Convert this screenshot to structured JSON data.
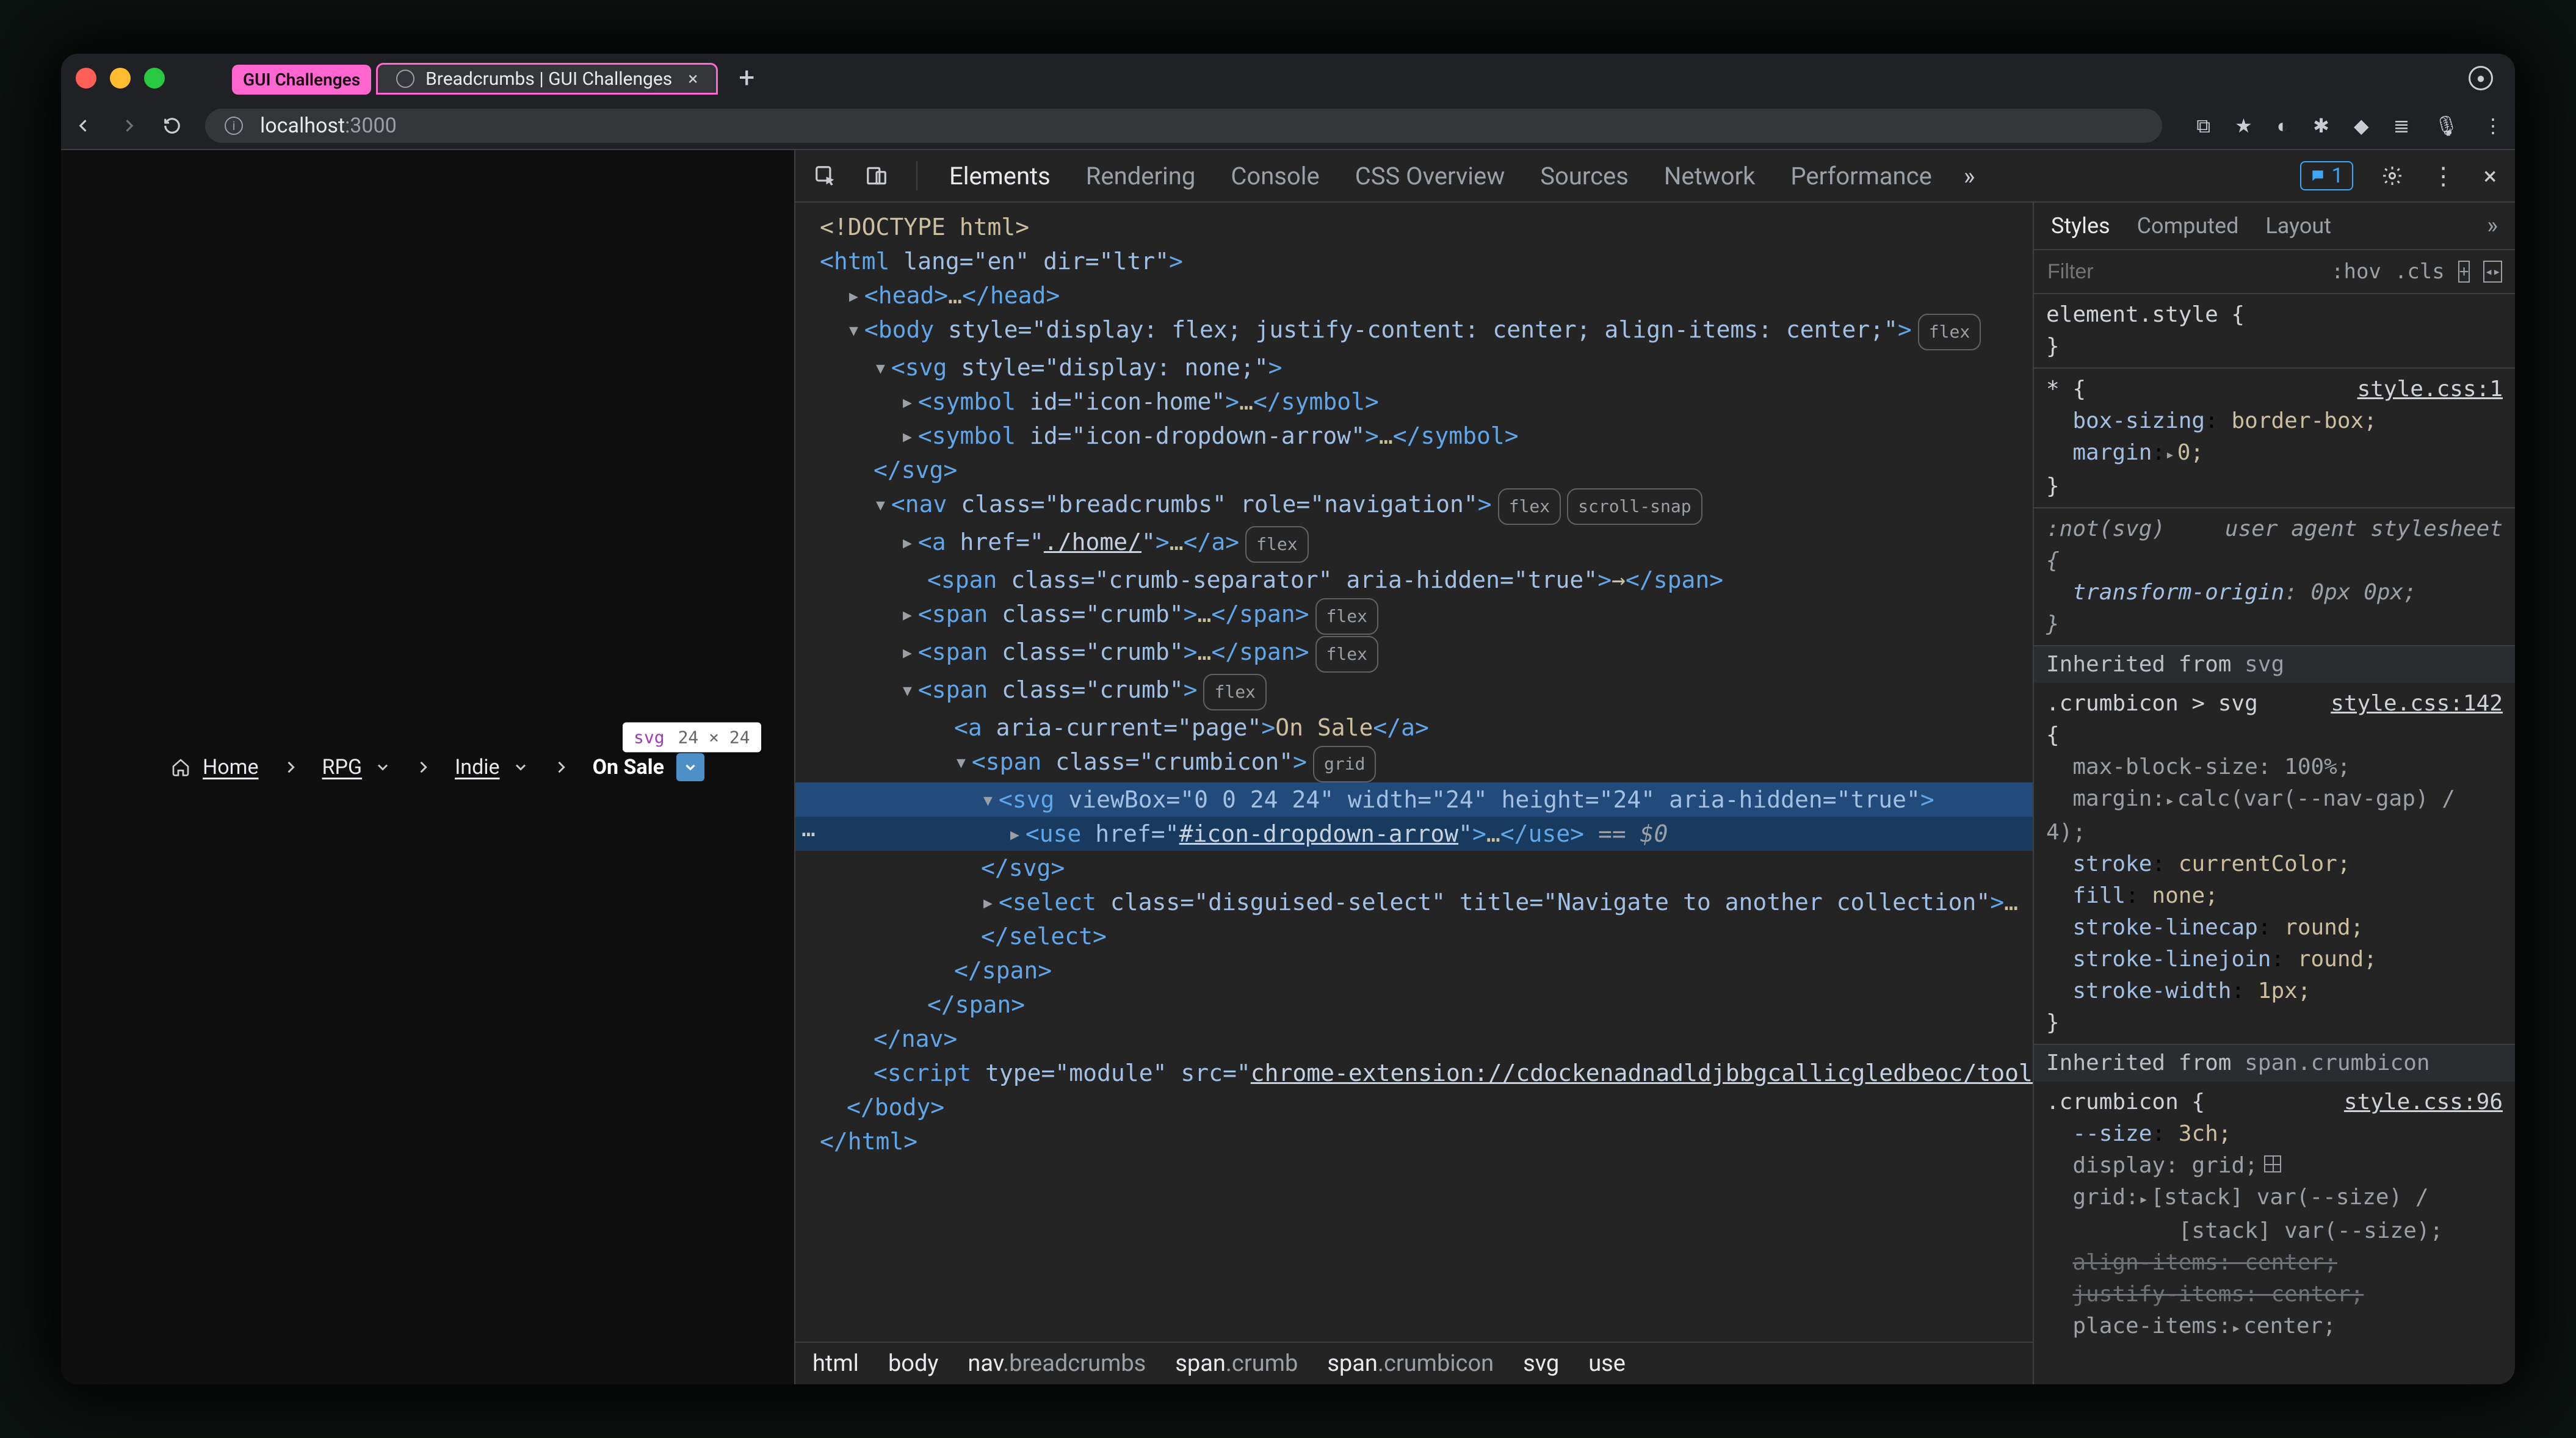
{
  "browser": {
    "tabs": [
      {
        "title": "GUI Challenges",
        "pink": true
      },
      {
        "title": "Breadcrumbs | GUI Challenges",
        "active": true
      }
    ],
    "url_host": "localhost",
    "url_port": ":3000"
  },
  "tooltip": {
    "tag": "svg",
    "dims": "24 × 24"
  },
  "breadcrumbs": {
    "home": "Home",
    "items": [
      "RPG",
      "Indie"
    ],
    "current": "On Sale"
  },
  "devtools": {
    "tabs": [
      "Elements",
      "Rendering",
      "Console",
      "CSS Overview",
      "Sources",
      "Network",
      "Performance"
    ],
    "badge": "1",
    "dom": {
      "doctype": "<!DOCTYPE html>",
      "html_open": "html",
      "html_lang": "lang=\"en\"",
      "html_dir": "dir=\"ltr\"",
      "head": "head",
      "body_style": "style=\"display: flex; justify-content: center; align-items: center;\"",
      "svg_style": "style=\"display: none;\"",
      "sym_home": "id=\"icon-home\"",
      "sym_dd": "id=\"icon-dropdown-arrow\"",
      "nav_class": "class=\"breadcrumbs\"",
      "nav_role": "role=\"navigation\"",
      "a_home_href": "./home/",
      "sep_class": "class=\"crumb-separator\"",
      "sep_aria": "aria-hidden=\"true\"",
      "crumb_class": "class=\"crumb\"",
      "a_current": "aria-current=\"page\"",
      "a_current_text": "On Sale",
      "crumbicon_class": "class=\"crumbicon\"",
      "svg_vb": "viewBox=\"0 0 24 24\"",
      "svg_w": "width=\"24\"",
      "svg_h": "height=\"24\"",
      "svg_aria": "aria-hidden=\"true\"",
      "use_href": "#icon-dropdown-arrow",
      "select_class": "class=\"disguised-select\"",
      "select_title": "title=\"Navigate to another collection\"",
      "script_type": "type=\"module\"",
      "script_src": "chrome-extension://cdockenadnadldjbbgcallicgledbeoc/toolbar/bundle.min.js"
    },
    "path": [
      "html",
      "body",
      "nav.breadcrumbs",
      "span.crumb",
      "span.crumbicon",
      "svg",
      "use"
    ]
  },
  "styles": {
    "tabs": [
      "Styles",
      "Computed",
      "Layout"
    ],
    "filter_placeholder": "Filter",
    "hov": ":hov",
    "cls": ".cls",
    "blocks": {
      "elstyle_sel": "element.style {",
      "uni_sel": "* {",
      "uni_src": "style.css:1",
      "uni_p1": "box-sizing",
      "uni_v1": "border-box;",
      "uni_p2": "margin",
      "uni_v2": "0;",
      "notsvg_sel": ":not(svg)",
      "notsvg_ua": "user agent stylesheet",
      "notsvg_p1": "transform-origin",
      "notsvg_v1": "0px 0px;",
      "inh1": "Inherited from",
      "inh1_from": "svg",
      "r1_sel": ".crumbicon > svg",
      "r1_src": "style.css:142",
      "r1_p1": "max-block-size",
      "r1_v1": "100%;",
      "r1_p2": "margin",
      "r1_v2": "calc(var(--nav-gap) / 4);",
      "r1_p3": "stroke",
      "r1_v3": "currentColor;",
      "r1_p4": "fill",
      "r1_v4": "none;",
      "r1_p5": "stroke-linecap",
      "r1_v5": "round;",
      "r1_p6": "stroke-linejoin",
      "r1_v6": "round;",
      "r1_p7": "stroke-width",
      "r1_v7": "1px;",
      "inh2": "Inherited from",
      "inh2_from": "span.crumbicon",
      "r2_sel": ".crumbicon {",
      "r2_src": "style.css:96",
      "r2_p1": "--size",
      "r2_v1": "3ch;",
      "r2_p2": "display",
      "r2_v2": "grid;",
      "r2_p3": "grid",
      "r2_v3": "[stack] var(--size) /",
      "r2_v3b": "[stack] var(--size);",
      "r2_p4": "align-items",
      "r2_v4": "center;",
      "r2_p5": "justify-items",
      "r2_v5": "center;",
      "r2_p6": "place-items",
      "r2_v6": "center;"
    }
  }
}
